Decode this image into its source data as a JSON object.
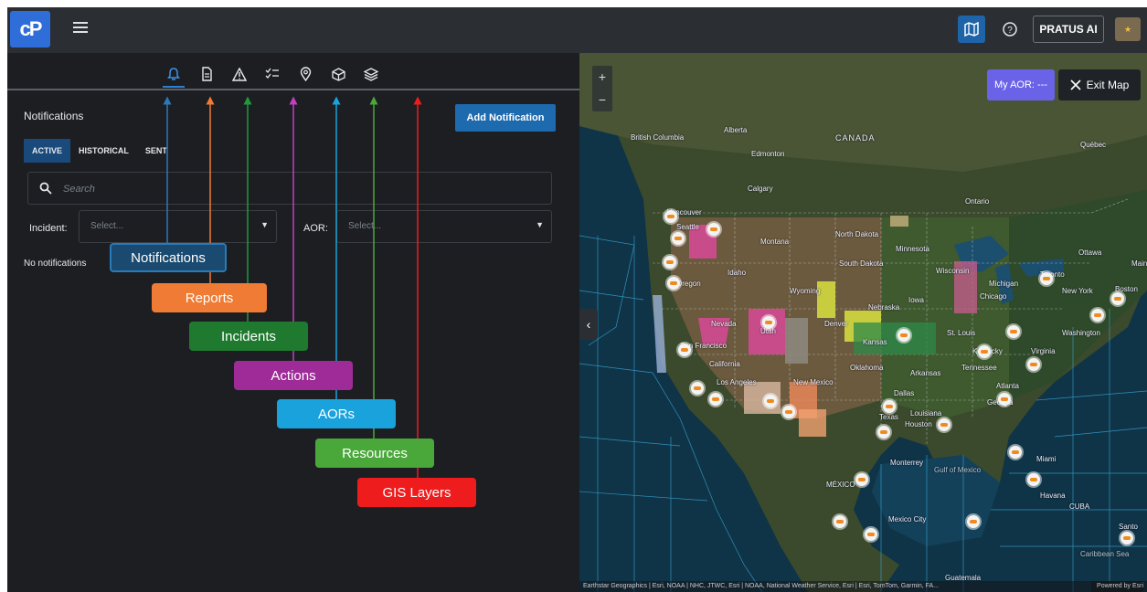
{
  "topbar": {
    "logo_text": "cP",
    "pratus_ai_label": "PRATUS AI",
    "accent": "#1f64a8"
  },
  "panel": {
    "title": "Notifications",
    "add_button": "Add Notification",
    "tabs": [
      {
        "label": "ACTIVE",
        "active": true
      },
      {
        "label": "HISTORICAL",
        "active": false
      },
      {
        "label": "SENT",
        "active": false
      }
    ],
    "search_placeholder": "Search",
    "incident_label": "Incident:",
    "incident_placeholder": "Select...",
    "aor_label": "AOR:",
    "aor_placeholder": "Select...",
    "empty_text": "No notifications"
  },
  "icon_bar": [
    {
      "name": "notifications",
      "icon": "bell-icon"
    },
    {
      "name": "reports",
      "icon": "document-icon"
    },
    {
      "name": "incidents",
      "icon": "warning-triangle-icon"
    },
    {
      "name": "actions",
      "icon": "checklist-icon"
    },
    {
      "name": "aors",
      "icon": "map-pin-icon"
    },
    {
      "name": "resources",
      "icon": "cube-icon"
    },
    {
      "name": "gis-layers",
      "icon": "layers-icon"
    }
  ],
  "callouts": [
    {
      "label": "Notifications",
      "color": "#1a4a70"
    },
    {
      "label": "Reports",
      "color": "#ef7b34"
    },
    {
      "label": "Incidents",
      "color": "#1f7a30"
    },
    {
      "label": "Actions",
      "color": "#9e2b98"
    },
    {
      "label": "AORs",
      "color": "#1aa2dd"
    },
    {
      "label": "Resources",
      "color": "#4aa83a"
    },
    {
      "label": "GIS Layers",
      "color": "#ee1c1c"
    }
  ],
  "map": {
    "my_aor_label": "My AOR: ---",
    "exit_map_label": "Exit Map",
    "zoom_in": "+",
    "zoom_out": "−",
    "collapse_glyph": "‹",
    "attribution": "Earthstar Geographics | Esri, NOAA | NHC, JTWC, Esri | NOAA, National Weather Service, Esri | Esri, TomTom, Garmin, FA...",
    "powered_by": "Powered by Esri",
    "labels": [
      "CANADA",
      "Alberta",
      "British Columbia",
      "Edmonton",
      "Calgary",
      "Québec",
      "Ontario",
      "Vancouver",
      "Seattle",
      "Montana",
      "North Dakota",
      "Minnesota",
      "South Dakota",
      "Ottawa",
      "Toronto",
      "New York",
      "Boston",
      "Chicago",
      "Wisconsin",
      "Michigan",
      "Oregon",
      "Idaho",
      "Wyoming",
      "Nebraska",
      "Iowa",
      "Denver",
      "Utah",
      "Nevada",
      "San Francisco",
      "Kansas",
      "St. Louis",
      "Kentucky",
      "Virginia",
      "Washington",
      "California",
      "Oklahoma",
      "Arkansas",
      "Tennessee",
      "Atlanta",
      "Los Angeles",
      "New Mexico",
      "Dallas",
      "Texas",
      "Louisiana",
      "Houston",
      "Georgia",
      "Miami",
      "Monterrey",
      "Gulf of Mexico",
      "Havana",
      "CUBA",
      "Mexico City",
      "Guatemala",
      "Caribbean Sea",
      "Santo",
      "MÉXICO",
      "Maine"
    ]
  }
}
